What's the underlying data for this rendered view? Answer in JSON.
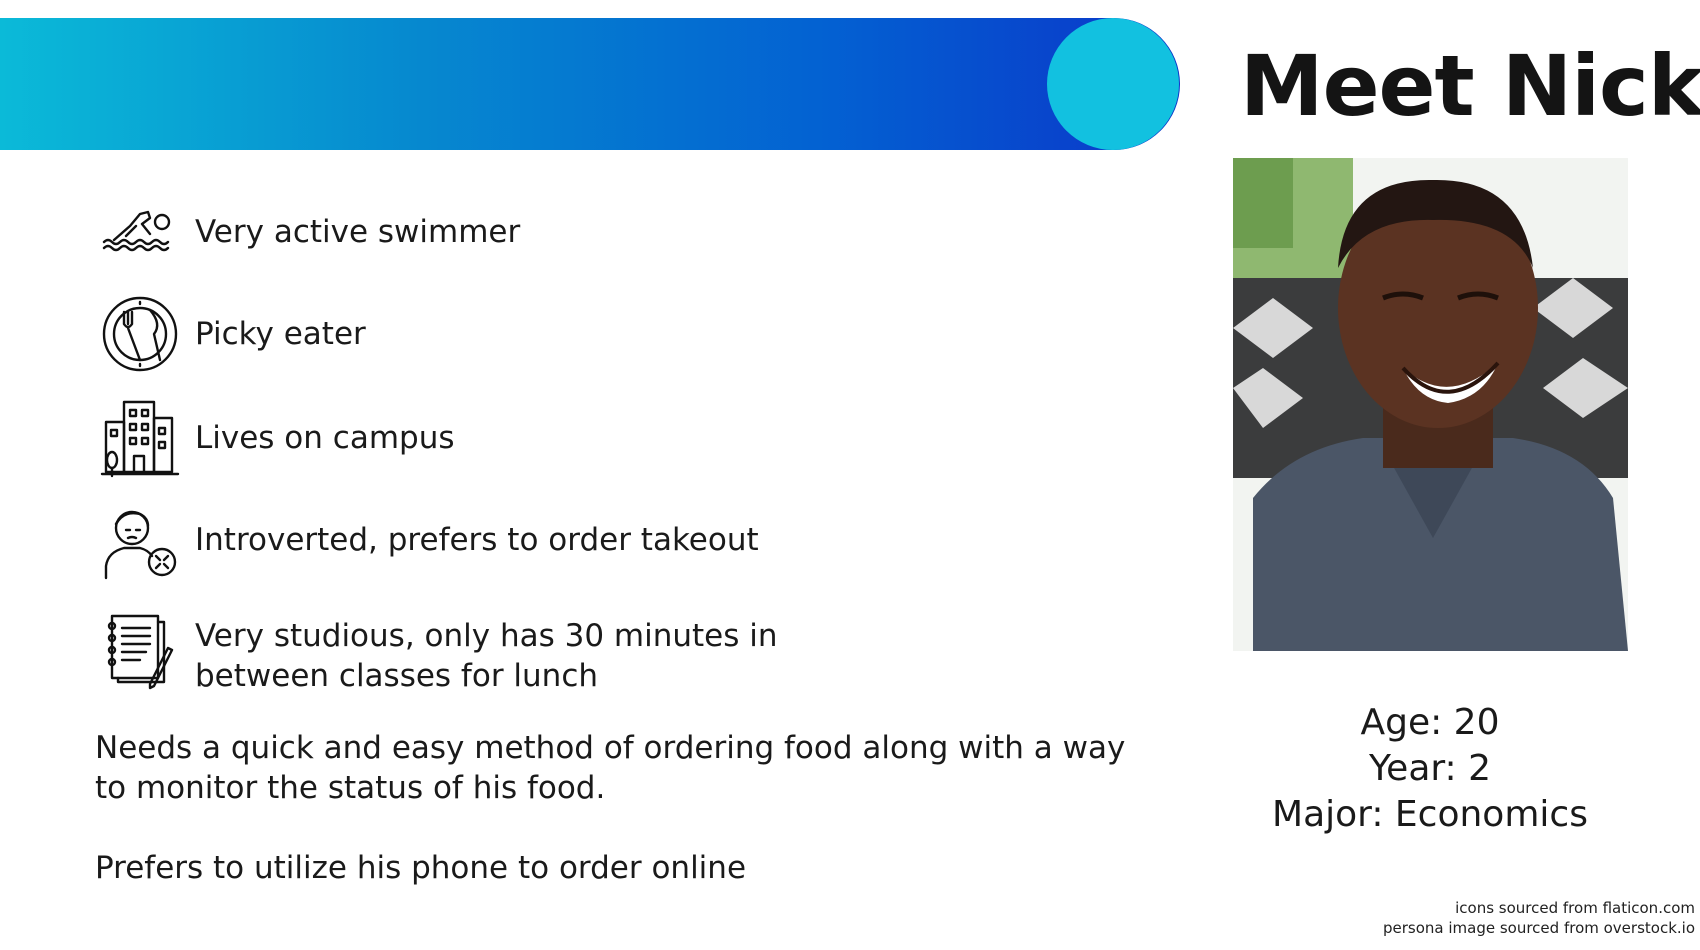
{
  "header": {
    "title": "Meet Nick!"
  },
  "traits": [
    {
      "icon": "swimmer-icon",
      "text": "Very active swimmer"
    },
    {
      "icon": "plate-cutlery-icon",
      "text": "Picky eater"
    },
    {
      "icon": "campus-buildings-icon",
      "text": "Lives on campus"
    },
    {
      "icon": "introvert-person-icon",
      "text": "Introverted, prefers to order takeout"
    },
    {
      "icon": "notebook-pencil-icon",
      "lines": [
        "Very studious, only has 30 minutes in",
        "between classes for lunch"
      ]
    }
  ],
  "needs": {
    "line1": "Needs a quick and easy method of ordering food along with a way",
    "line2": "to monitor the status of his food.",
    "prefers": "Prefers to utilize his phone to order online"
  },
  "profile": {
    "age": "Age: 20",
    "year": "Year: 2",
    "major": "Major: Economics"
  },
  "credits": {
    "icons": "icons sourced from flaticon.com",
    "image": "persona image sourced from overstock.io"
  },
  "colors": {
    "banner_start": "#0bbad8",
    "banner_end": "#0b36c9",
    "banner_dot": "#12c1e0"
  }
}
